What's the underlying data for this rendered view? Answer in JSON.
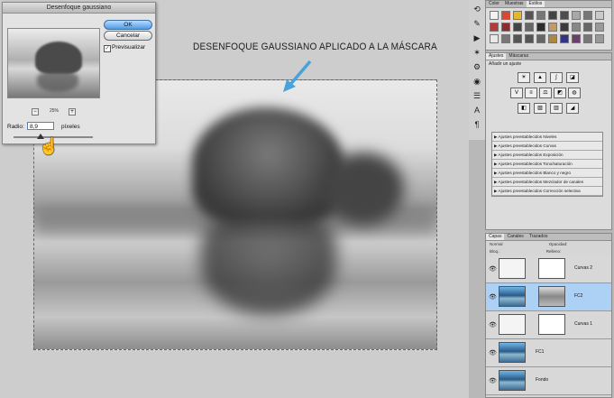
{
  "caption": "DESENFOQUE GAUSSIANO APLICADO A LA MÁSCARA",
  "dialog": {
    "title": "Desenfoque gaussiano",
    "ok_label": "OK",
    "cancel_label": "Cancelar",
    "preview_label": "Previsualizar",
    "preview_checked": "✓",
    "zoom_minus": "−",
    "zoom_plus": "+",
    "zoom_value": "25%",
    "radius_label": "Radio:",
    "radius_value": "8,9",
    "radius_unit": "píxeles",
    "radius_slider_fraction": 0.34
  },
  "swatches_panel": {
    "tabs": [
      "Color",
      "Muestras",
      "Estilos"
    ],
    "active_tab": "Estilos",
    "colors": [
      "#f2f2f2",
      "#e0452f",
      "#e7b72a",
      "#555555",
      "#777777",
      "#444444",
      "#4d4d4d",
      "#a8a8a8",
      "#777777",
      "#c9c9c9",
      "#b33a3a",
      "#8f2a2a",
      "#444444",
      "#666666",
      "#2c2c2c",
      "#bf9a6a",
      "#3b3b3b",
      "#888888",
      "#666666",
      "#9a9a9a",
      "#e8e8e8",
      "#777777",
      "#555555",
      "#555555",
      "#666666",
      "#aa8844",
      "#333388",
      "#6b3f6b",
      "#777777",
      "#999999"
    ]
  },
  "adjustments_panel": {
    "tabs": [
      "Ajustes",
      "Máscaras"
    ],
    "active_tab": "Ajustes",
    "hint": "Añadir un ajuste",
    "presets": [
      "Ajustes preestablecidos Niveles",
      "Ajustes preestablecidos Curvas",
      "Ajustes preestablecidos Exposición",
      "Ajustes preestablecidos Tono/saturación",
      "Ajustes preestablecidos Blanco y negro",
      "Ajustes preestablecidos Mezclador de canales",
      "Ajustes preestablecidos Corrección selectiva"
    ]
  },
  "layers_panel": {
    "tabs": [
      "Capas",
      "Canales",
      "Trazados"
    ],
    "active_tab": "Capas",
    "blend_mode": "Normal",
    "opacity_label": "Opacidad:",
    "lock_label": "Bloq.:",
    "fill_label": "Relleno:",
    "layers": [
      {
        "name": "Curvas 2",
        "selected": false
      },
      {
        "name": "FC2",
        "selected": true
      },
      {
        "name": "Curvas 1",
        "selected": false
      },
      {
        "name": "FC1",
        "selected": false
      },
      {
        "name": "Fondo",
        "selected": false
      }
    ]
  }
}
